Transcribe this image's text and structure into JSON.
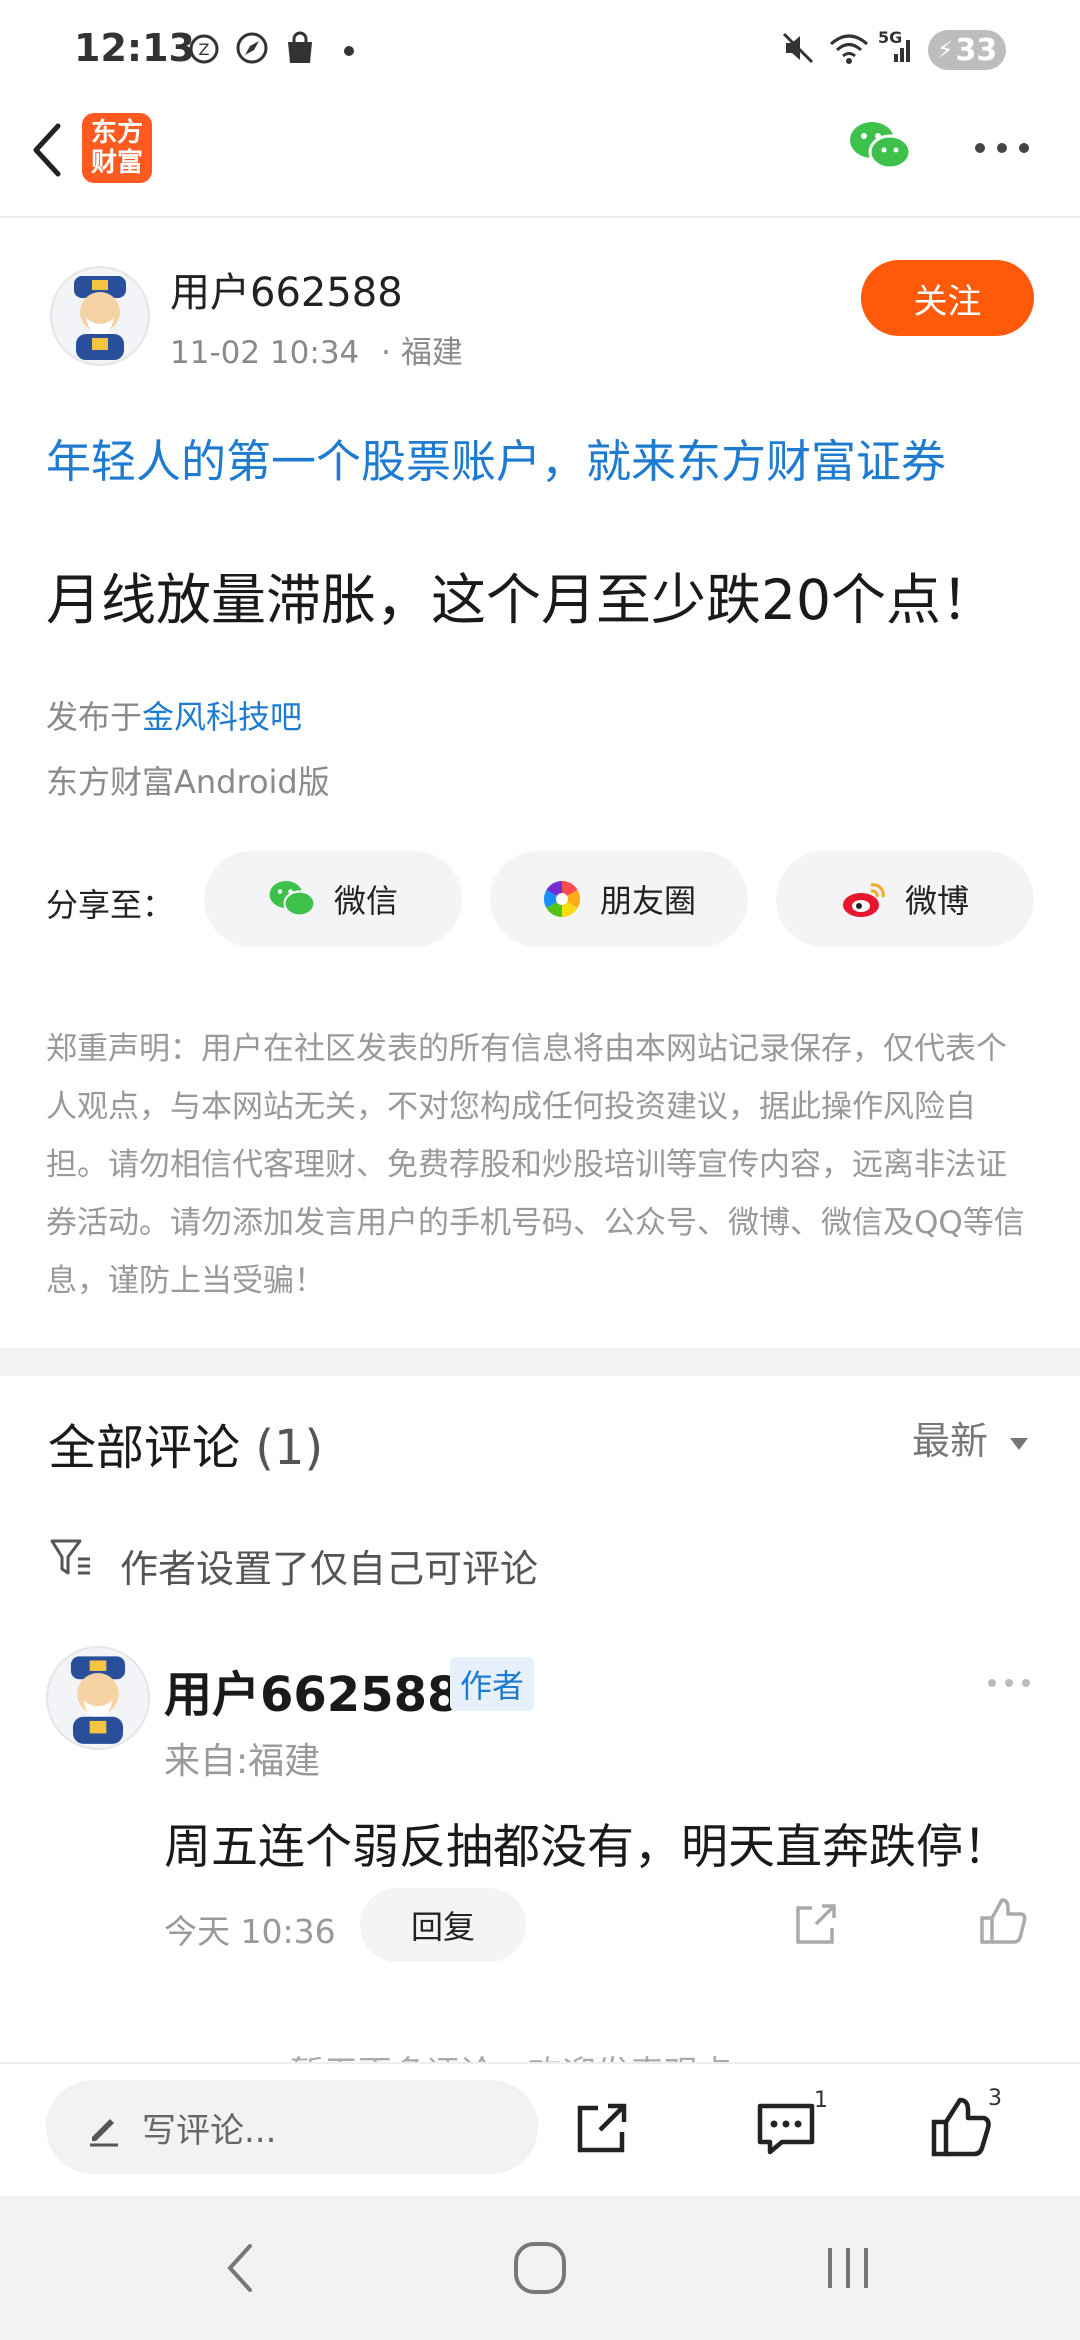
{
  "status_bar": {
    "time": "12:13",
    "battery": "33",
    "network": "5G",
    "icons": [
      "alarm-icon",
      "compass-icon",
      "shopping-bag-icon",
      "dot-icon",
      "mute-icon",
      "wifi-icon",
      "signal-icon",
      "battery-icon"
    ]
  },
  "nav": {
    "back_icon": "chevron-left-icon",
    "logo_line1": "东方",
    "logo_line2": "财富",
    "wechat_icon": "wechat-icon",
    "more_icon": "more-horizontal-icon"
  },
  "post": {
    "author": "用户662588",
    "date": "11-02 10:34",
    "location": "· 福建",
    "follow_label": "关注",
    "promo": "年轻人的第一个股票账户，就来东方财富证券",
    "title": "月线放量滞胀，这个月至少跌20个点！",
    "published_prefix": "发布于",
    "published_forum": "金风科技吧",
    "source": "东方财富Android版"
  },
  "share": {
    "label": "分享至：",
    "buttons": [
      {
        "label": "微信",
        "icon": "wechat-icon"
      },
      {
        "label": "朋友圈",
        "icon": "moments-icon"
      },
      {
        "label": "微博",
        "icon": "weibo-icon"
      }
    ]
  },
  "disclaimer": "郑重声明：用户在社区发表的所有信息将由本网站记录保存，仅代表个人观点，与本网站无关，不对您构成任何投资建议，据此操作风险自担。请勿相信代客理财、免费荐股和炒股培训等宣传内容，远离非法证券活动。请勿添加发言用户的手机号码、公众号、微博、微信及QQ等信息，谨防上当受骗！",
  "comments": {
    "title": "全部评论",
    "count": "(1)",
    "sort_label": "最新",
    "notice": "作者设置了仅自己可评论",
    "items": [
      {
        "author": "用户662588",
        "badge": "作者",
        "from": "来自:福建",
        "text": "周五连个弱反抽都没有，明天直奔跌停！",
        "time": "今天 10:36",
        "reply_label": "回复"
      }
    ],
    "footer_hint": "暂无更多评论，欢迎发表观点"
  },
  "action_bar": {
    "write_placeholder": "写评论...",
    "comment_count": "1",
    "like_count": "3"
  },
  "colors": {
    "accent": "#ff5a0a",
    "link": "#1e7bd0",
    "wechat_green": "#3ec14b",
    "weibo_red": "#e6162d"
  }
}
